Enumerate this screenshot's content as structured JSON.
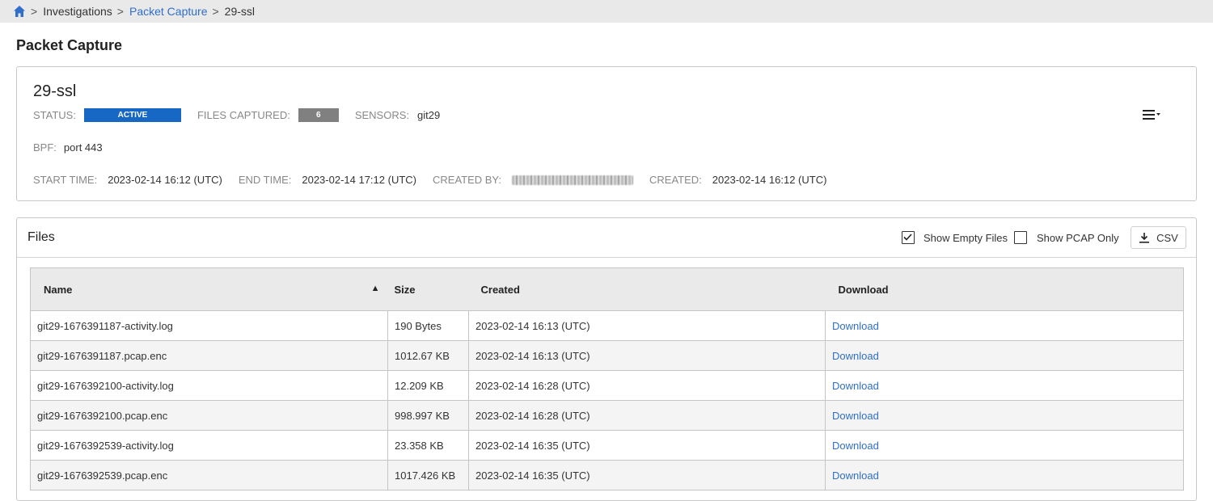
{
  "breadcrumb": {
    "home_icon": "home-icon",
    "separator": ">",
    "items": [
      "Investigations",
      "Packet Capture",
      "29-ssl"
    ]
  },
  "page_title": "Packet Capture",
  "capture": {
    "name": "29-ssl",
    "status_label": "STATUS:",
    "status_value": "ACTIVE",
    "files_captured_label": "FILES CAPTURED:",
    "files_captured_value": "6",
    "sensors_label": "SENSORS:",
    "sensors_value": "git29",
    "bpf_label": "BPF:",
    "bpf_value": "port 443",
    "start_time_label": "START TIME:",
    "start_time_value": "2023-02-14 16:12 (UTC)",
    "end_time_label": "END TIME:",
    "end_time_value": "2023-02-14 17:12 (UTC)",
    "created_by_label": "CREATED BY:",
    "created_label": "CREATED:",
    "created_value": "2023-02-14 16:12 (UTC)",
    "menu_icon": "list-menu-icon"
  },
  "files": {
    "title": "Files",
    "show_empty_label": "Show Empty Files",
    "show_empty_checked": true,
    "show_pcap_label": "Show PCAP Only",
    "show_pcap_checked": false,
    "csv_label": "CSV",
    "columns": [
      "Name",
      "Size",
      "Created",
      "Download"
    ],
    "sort_indicator": "▲",
    "rows": [
      {
        "name": "git29-1676391187-activity.log",
        "size": "190 Bytes",
        "created": "2023-02-14 16:13 (UTC)",
        "download": "Download"
      },
      {
        "name": "git29-1676391187.pcap.enc",
        "size": "1012.67 KB",
        "created": "2023-02-14 16:13 (UTC)",
        "download": "Download"
      },
      {
        "name": "git29-1676392100-activity.log",
        "size": "12.209 KB",
        "created": "2023-02-14 16:28 (UTC)",
        "download": "Download"
      },
      {
        "name": "git29-1676392100.pcap.enc",
        "size": "998.997 KB",
        "created": "2023-02-14 16:28 (UTC)",
        "download": "Download"
      },
      {
        "name": "git29-1676392539-activity.log",
        "size": "23.358 KB",
        "created": "2023-02-14 16:35 (UTC)",
        "download": "Download"
      },
      {
        "name": "git29-1676392539.pcap.enc",
        "size": "1017.426 KB",
        "created": "2023-02-14 16:35 (UTC)",
        "download": "Download"
      }
    ]
  },
  "colors": {
    "link": "#2f6fc9",
    "status_active": "#1768c4",
    "count_badge": "#808080"
  }
}
